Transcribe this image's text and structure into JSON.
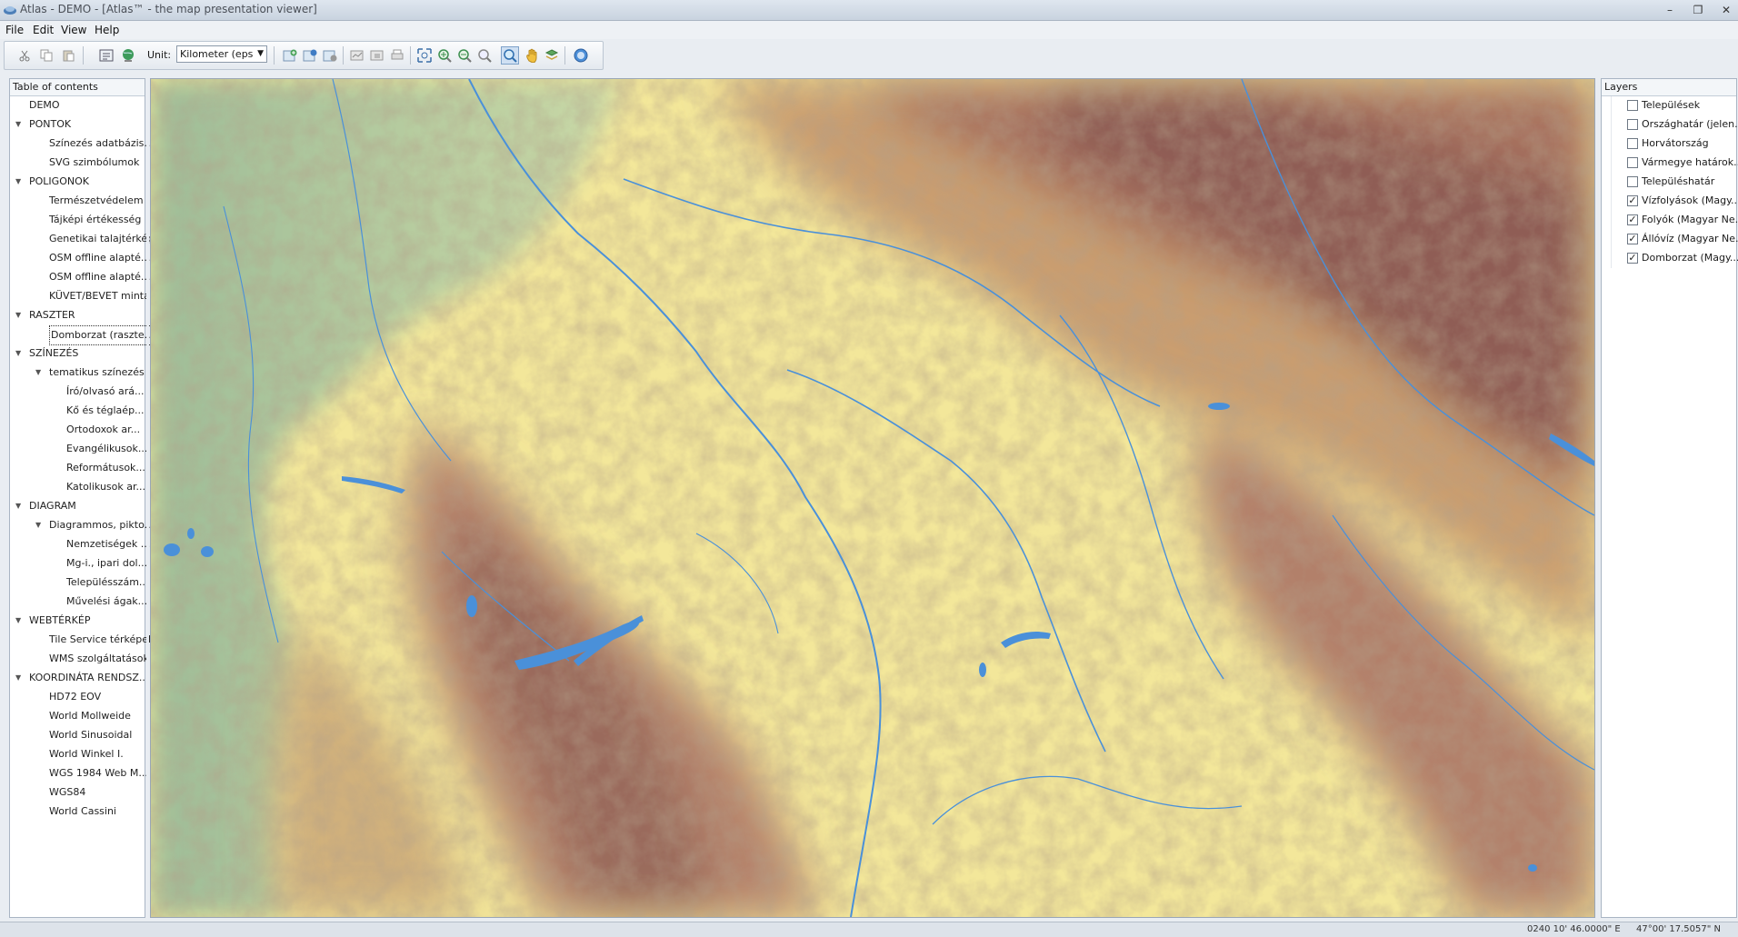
{
  "window": {
    "title": "Atlas - DEMO - [Atlas™ - the map presentation viewer]",
    "minimize": "–",
    "restore": "❐",
    "close": "✕"
  },
  "menu": [
    "File",
    "Edit",
    "View",
    "Help"
  ],
  "toolbar": {
    "unit_label": "Unit:",
    "unit_value": "Kilometer (eps"
  },
  "toc": {
    "header": "Table of contents",
    "items": [
      {
        "label": "DEMO",
        "level": 0,
        "caret": ""
      },
      {
        "label": "PONTOK",
        "level": 0,
        "caret": "▼"
      },
      {
        "label": "Színezés adatbázis...",
        "level": 1,
        "caret": ""
      },
      {
        "label": "SVG szimbólumok",
        "level": 1,
        "caret": ""
      },
      {
        "label": "POLIGONOK",
        "level": 0,
        "caret": "▼"
      },
      {
        "label": "Természetvédelem",
        "level": 1,
        "caret": ""
      },
      {
        "label": "Tájképi értékesség",
        "level": 1,
        "caret": ""
      },
      {
        "label": "Genetikai talajtérkép",
        "level": 1,
        "caret": ""
      },
      {
        "label": "OSM offline alapté...",
        "level": 1,
        "caret": ""
      },
      {
        "label": "OSM offline alapté...",
        "level": 1,
        "caret": ""
      },
      {
        "label": "KÜVET/BEVET minta",
        "level": 1,
        "caret": ""
      },
      {
        "label": "RASZTER",
        "level": 0,
        "caret": "▼"
      },
      {
        "label": "Domborzat (raszte...",
        "level": 1,
        "caret": "",
        "selected": true
      },
      {
        "label": "SZÍNEZÉS",
        "level": 0,
        "caret": "▼"
      },
      {
        "label": "tematikus színezés",
        "level": 1,
        "caret": "▼"
      },
      {
        "label": "Író/olvasó ará...",
        "level": 2,
        "caret": ""
      },
      {
        "label": "Kő és téglaép...",
        "level": 2,
        "caret": ""
      },
      {
        "label": "Ortodoxok ar...",
        "level": 2,
        "caret": ""
      },
      {
        "label": "Evangélikusok...",
        "level": 2,
        "caret": ""
      },
      {
        "label": "Reformátusok...",
        "level": 2,
        "caret": ""
      },
      {
        "label": "Katolikusok ar...",
        "level": 2,
        "caret": ""
      },
      {
        "label": "DIAGRAM",
        "level": 0,
        "caret": "▼"
      },
      {
        "label": "Diagrammos, pikto...",
        "level": 1,
        "caret": "▼"
      },
      {
        "label": "Nemzetiségek ...",
        "level": 2,
        "caret": ""
      },
      {
        "label": "Mg-i., ipari dol...",
        "level": 2,
        "caret": ""
      },
      {
        "label": "Településszám...",
        "level": 2,
        "caret": ""
      },
      {
        "label": "Művelési ágak...",
        "level": 2,
        "caret": ""
      },
      {
        "label": "WEBTÉRKÉP",
        "level": 0,
        "caret": "▼"
      },
      {
        "label": "Tile Service térképek",
        "level": 1,
        "caret": ""
      },
      {
        "label": "WMS szolgáltatások",
        "level": 1,
        "caret": ""
      },
      {
        "label": "KOORDINÁTA RENDSZ...",
        "level": 0,
        "caret": "▼"
      },
      {
        "label": "HD72 EOV",
        "level": 1,
        "caret": ""
      },
      {
        "label": "World Mollweide",
        "level": 1,
        "caret": ""
      },
      {
        "label": "World Sinusoidal",
        "level": 1,
        "caret": ""
      },
      {
        "label": "World Winkel I.",
        "level": 1,
        "caret": ""
      },
      {
        "label": "WGS 1984 Web M...",
        "level": 1,
        "caret": ""
      },
      {
        "label": "WGS84",
        "level": 1,
        "caret": ""
      },
      {
        "label": "World Cassini",
        "level": 1,
        "caret": ""
      }
    ]
  },
  "layers": {
    "header": "Layers",
    "items": [
      {
        "label": "Települések",
        "checked": false
      },
      {
        "label": "Országhatár (jelen...",
        "checked": false
      },
      {
        "label": "Horvátország",
        "checked": false
      },
      {
        "label": "Vármegye határok...",
        "checked": false
      },
      {
        "label": "Településhatár",
        "checked": false
      },
      {
        "label": "Vízfolyások (Magy...",
        "checked": true
      },
      {
        "label": "Folyók (Magyar Ne...",
        "checked": true
      },
      {
        "label": "Állóvíz (Magyar Ne...",
        "checked": true
      },
      {
        "label": "Domborzat (Magy...",
        "checked": true
      }
    ]
  },
  "status": {
    "coord_x": "0240 10' 46.0000\" E",
    "coord_y": "47°00' 17.5057\" N"
  },
  "colors": {
    "lowland": "#f3e79a",
    "plain": "#e9dd88",
    "hills": "#d9b572",
    "mountain": "#a9705e",
    "peak": "#8d5a55",
    "green_low": "#a9c3a0",
    "water": "#4a90d9"
  }
}
